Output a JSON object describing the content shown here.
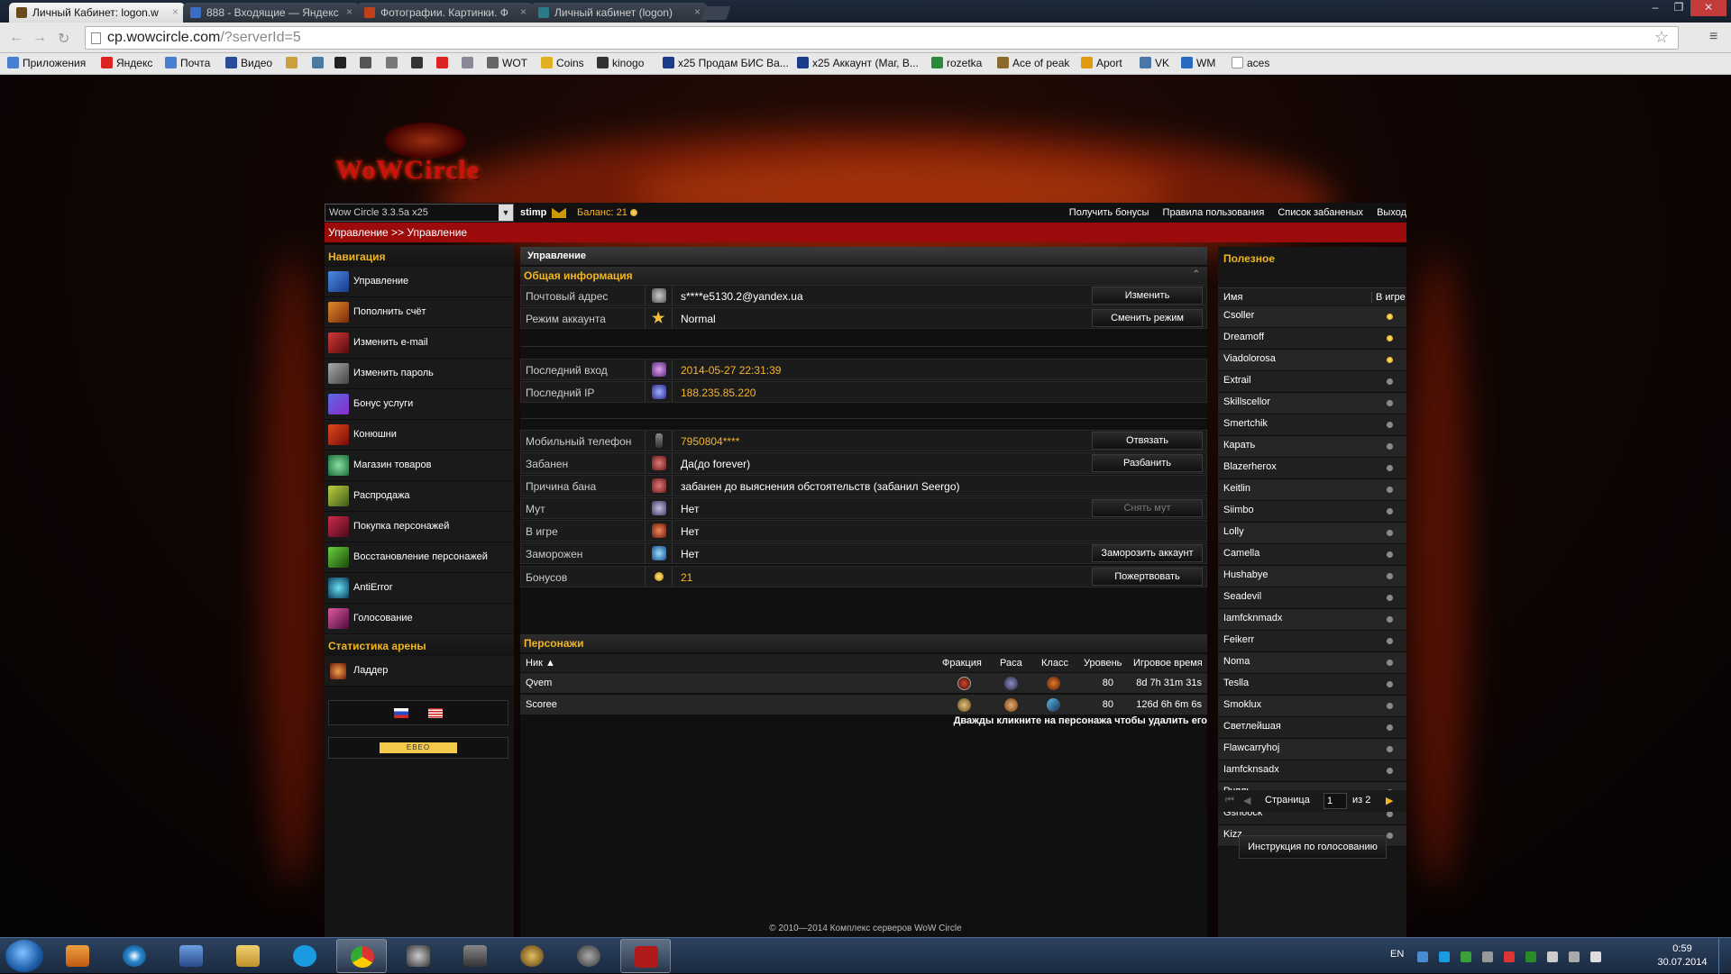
{
  "browser": {
    "tabs": [
      {
        "title": "Личный Кабинет: logon.w",
        "active": true
      },
      {
        "title": "888 - Входящие — Яндекс"
      },
      {
        "title": "Фотографии. Картинки. Ф"
      },
      {
        "title": "Личный кабинет (logon)"
      }
    ],
    "url_main": "cp.wowcircle.com",
    "url_rest": "/?serverId=5",
    "window_controls": [
      "–",
      "❐",
      "✕"
    ],
    "bookmarks": [
      "Приложения",
      "Яндекс",
      "Почта",
      "Видео",
      "WOT",
      "Coins",
      "kinogo",
      "x25 Продам БИС Ва...",
      "x25 Аккаунт (Маг, В...",
      "rozetka",
      "Ace of peak",
      "Aport",
      "VK",
      "WM",
      "aces"
    ]
  },
  "site": {
    "logo": "WoWCircle",
    "server_select": "Wow Circle 3.3.5a x25",
    "username": "stimp",
    "balance_label": "Баланс:",
    "balance_value": "21",
    "top_links": [
      "Получить бонусы",
      "Правила пользования",
      "Список забаненых",
      "Выход"
    ],
    "breadcrumb": "Управление >> Управление",
    "nav_title": "Навигация",
    "nav_items": [
      "Управление",
      "Пополнить счёт",
      "Изменить e-mail",
      "Изменить пароль",
      "Бонус услуги",
      "Конюшни",
      "Магазин товаров",
      "Распродажа",
      "Покупка персонажей",
      "Восстановление персонажей",
      "AntiError",
      "Голосование"
    ],
    "arena_title": "Статистика арены",
    "arena_items": [
      "Ладдер"
    ],
    "eveo": "EBEO",
    "center_title": "Управление",
    "general_title": "Общая информация",
    "info": {
      "email": {
        "label": "Почтовый адрес",
        "value": "s****e5130.2@yandex.ua",
        "button": "Изменить"
      },
      "mode": {
        "label": "Режим аккаунта",
        "value": "Normal",
        "button": "Сменить режим"
      },
      "last_login": {
        "label": "Последний вход",
        "value": "2014-05-27 22:31:39"
      },
      "last_ip": {
        "label": "Последний IP",
        "value": "188.235.85.220"
      },
      "phone": {
        "label": "Мобильный телефон",
        "value": "7950804****",
        "button": "Отвязать"
      },
      "banned": {
        "label": "Забанен",
        "value": "Да(до forever)",
        "button": "Разбанить"
      },
      "ban_reason": {
        "label": "Причина бана",
        "value": "забанен до выяснения обстоятельств (забанил Seergo)"
      },
      "mute": {
        "label": "Мут",
        "value": "Нет",
        "button": "Снять мут"
      },
      "ingame": {
        "label": "В игре",
        "value": "Нет"
      },
      "frozen": {
        "label": "Заморожен",
        "value": "Нет",
        "button": "Заморозить аккаунт"
      },
      "bonuses": {
        "label": "Бонусов",
        "value": "21",
        "button": "Пожертвовать"
      }
    },
    "chars_title": "Персонажи",
    "chars_columns": [
      "Ник ▲",
      "Фракция",
      "Раса",
      "Класс",
      "Уровень",
      "Игровое время"
    ],
    "characters": [
      {
        "name": "Qvem",
        "level": "80",
        "time": "8d 7h 31m 31s"
      },
      {
        "name": "Scoree",
        "level": "80",
        "time": "126d 6h 6m 6s"
      }
    ],
    "chars_hint": "Дважды кликните на персонажа чтобы удалить его",
    "useful_title": "Полезное",
    "players_columns": [
      "Имя",
      "В игре"
    ],
    "players": [
      {
        "name": "Csoller",
        "online": true
      },
      {
        "name": "Dreamoff",
        "online": true
      },
      {
        "name": "Viadolorosa",
        "online": true
      },
      {
        "name": "Extrail",
        "online": false
      },
      {
        "name": "Skillscellor",
        "online": false
      },
      {
        "name": "Smertchik",
        "online": false
      },
      {
        "name": "Карать",
        "online": false
      },
      {
        "name": "Blazerherox",
        "online": false
      },
      {
        "name": "Keitlin",
        "online": false
      },
      {
        "name": "Siimbo",
        "online": false
      },
      {
        "name": "Lolly",
        "online": false
      },
      {
        "name": "Camella",
        "online": false
      },
      {
        "name": "Hushabye",
        "online": false
      },
      {
        "name": "Seadevil",
        "online": false
      },
      {
        "name": "Iamfcknmadx",
        "online": false
      },
      {
        "name": "Feikerr",
        "online": false
      },
      {
        "name": "Noma",
        "online": false
      },
      {
        "name": "Teslla",
        "online": false
      },
      {
        "name": "Smoklux",
        "online": false
      },
      {
        "name": "Светлейшая",
        "online": false
      },
      {
        "name": "Flawcarryhoj",
        "online": false
      },
      {
        "name": "Iamfcknsadx",
        "online": false
      },
      {
        "name": "Рулль",
        "online": false
      },
      {
        "name": "Gshoock",
        "online": false
      },
      {
        "name": "Kizz",
        "online": false
      }
    ],
    "pager": {
      "label": "Страница",
      "page": "1",
      "of": "из 2"
    },
    "vote_button": "Инструкция по голосованию",
    "footer": "© 2010—2014 Комплекс серверов WoW Circle"
  },
  "taskbar": {
    "lang": "EN",
    "time": "0:59",
    "date": "30.07.2014"
  }
}
